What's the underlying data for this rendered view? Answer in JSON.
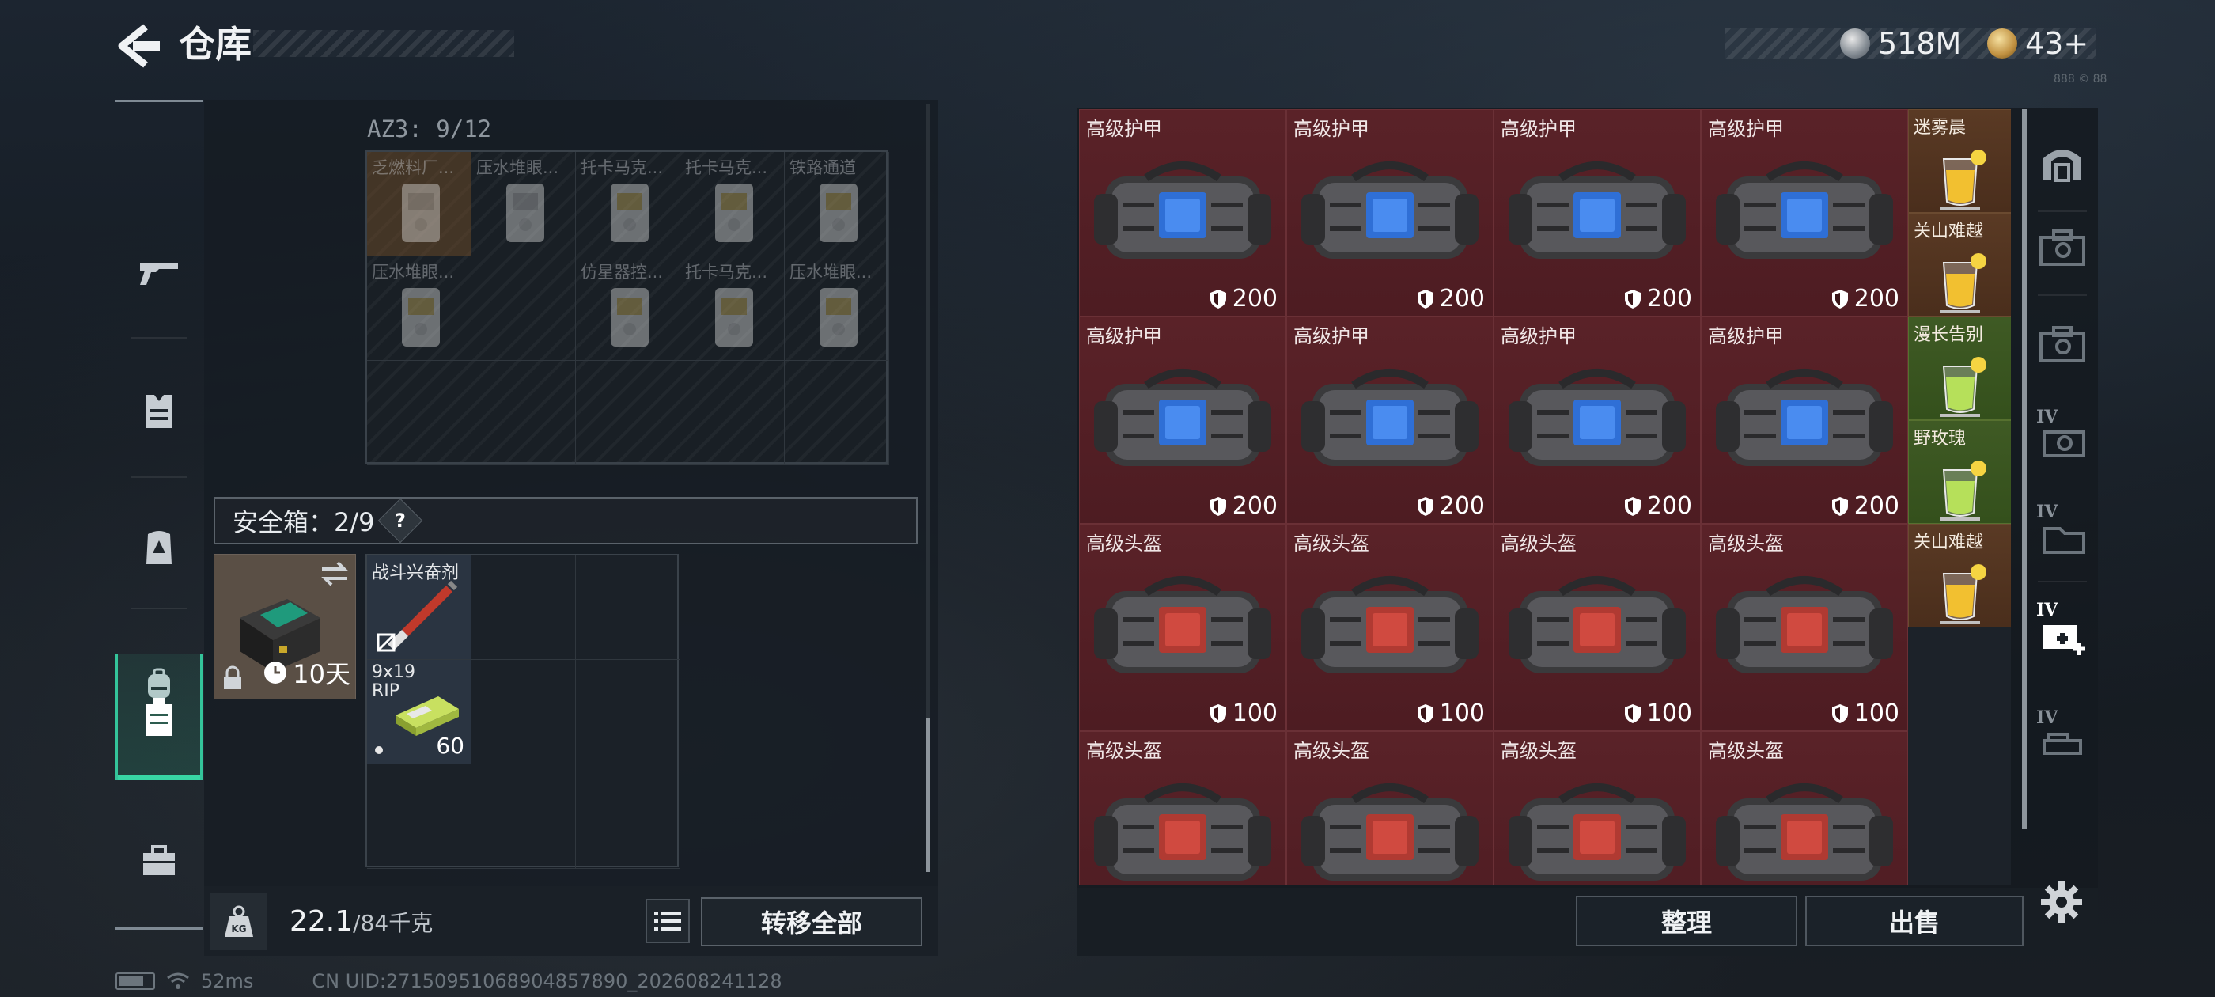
{
  "header": {
    "title": "仓库"
  },
  "currency": {
    "silver": "518M",
    "gold": "43+"
  },
  "version": "888 © 88",
  "left_sidebar": {
    "items": [
      {
        "icon": "gun-icon",
        "active": false
      },
      {
        "icon": "armor-vest-icon",
        "active": false
      },
      {
        "icon": "chest-rig-icon",
        "active": false
      },
      {
        "icon": "backpack-icon",
        "active": false
      },
      {
        "icon": "safebox-icon",
        "active": true
      },
      {
        "icon": "briefcase-icon",
        "active": false
      }
    ]
  },
  "container": {
    "label": "AZ3: 9/12",
    "items": [
      {
        "name": "乏燃料厂...",
        "slot": 0
      },
      {
        "name": "压水堆眼...",
        "slot": 1
      },
      {
        "name": "托卡马克...",
        "slot": 2
      },
      {
        "name": "托卡马克...",
        "slot": 3
      },
      {
        "name": "铁路通道",
        "slot": 4
      },
      {
        "name": "压水堆眼...",
        "slot": 5
      },
      {
        "name": "仿星器控...",
        "slot": 7
      },
      {
        "name": "托卡马克...",
        "slot": 8
      },
      {
        "name": "压水堆眼...",
        "slot": 9
      }
    ]
  },
  "safebox": {
    "label": "安全箱：2/9",
    "help": "?",
    "timer": "10天",
    "items": [
      {
        "name": "战斗兴奋剂"
      },
      {
        "name": "9x19 RIP",
        "count": "60"
      }
    ]
  },
  "weight": {
    "current": "22.1",
    "max": "/84千克"
  },
  "buttons": {
    "transfer_all": "转移全部",
    "sort": "整理",
    "sell": "出售"
  },
  "status": {
    "ping": "52ms",
    "uid": "CN UID:27150951068904857890_202608241128"
  },
  "warehouse": {
    "bags": [
      {
        "name": "高级护甲",
        "durability": "200",
        "kind": "armor"
      },
      {
        "name": "高级护甲",
        "durability": "200",
        "kind": "armor"
      },
      {
        "name": "高级护甲",
        "durability": "200",
        "kind": "armor"
      },
      {
        "name": "高级护甲",
        "durability": "200",
        "kind": "armor"
      },
      {
        "name": "高级护甲",
        "durability": "200",
        "kind": "armor"
      },
      {
        "name": "高级护甲",
        "durability": "200",
        "kind": "armor"
      },
      {
        "name": "高级护甲",
        "durability": "200",
        "kind": "armor"
      },
      {
        "name": "高级护甲",
        "durability": "200",
        "kind": "armor"
      },
      {
        "name": "高级头盔",
        "durability": "100",
        "kind": "helmet"
      },
      {
        "name": "高级头盔",
        "durability": "100",
        "kind": "helmet"
      },
      {
        "name": "高级头盔",
        "durability": "100",
        "kind": "helmet"
      },
      {
        "name": "高级头盔",
        "durability": "100",
        "kind": "helmet"
      },
      {
        "name": "高级头盔",
        "durability": "",
        "kind": "helmet"
      },
      {
        "name": "高级头盔",
        "durability": "",
        "kind": "helmet"
      },
      {
        "name": "高级头盔",
        "durability": "",
        "kind": "helmet"
      },
      {
        "name": "高级头盔",
        "durability": "",
        "kind": "helmet"
      }
    ],
    "drinks": [
      {
        "name": "迷雾晨",
        "color": "orange"
      },
      {
        "name": "关山难越",
        "color": "orange"
      },
      {
        "name": "漫长告别",
        "color": "green"
      },
      {
        "name": "野玫瑰",
        "color": "green"
      },
      {
        "name": "关山难越",
        "color": "orange"
      }
    ]
  },
  "right_sidebar": {
    "items": [
      {
        "icon": "warehouse-home-icon",
        "label": ""
      },
      {
        "icon": "expansion-box-icon",
        "label": ""
      },
      {
        "icon": "expansion-box-icon",
        "label": ""
      },
      {
        "icon": "expansion-box-icon",
        "label": "IV"
      },
      {
        "icon": "expansion-box-icon",
        "label": "IV"
      },
      {
        "icon": "expansion-add-icon",
        "label": "IV"
      },
      {
        "icon": "expansion-box-icon",
        "label": "IV"
      }
    ]
  }
}
